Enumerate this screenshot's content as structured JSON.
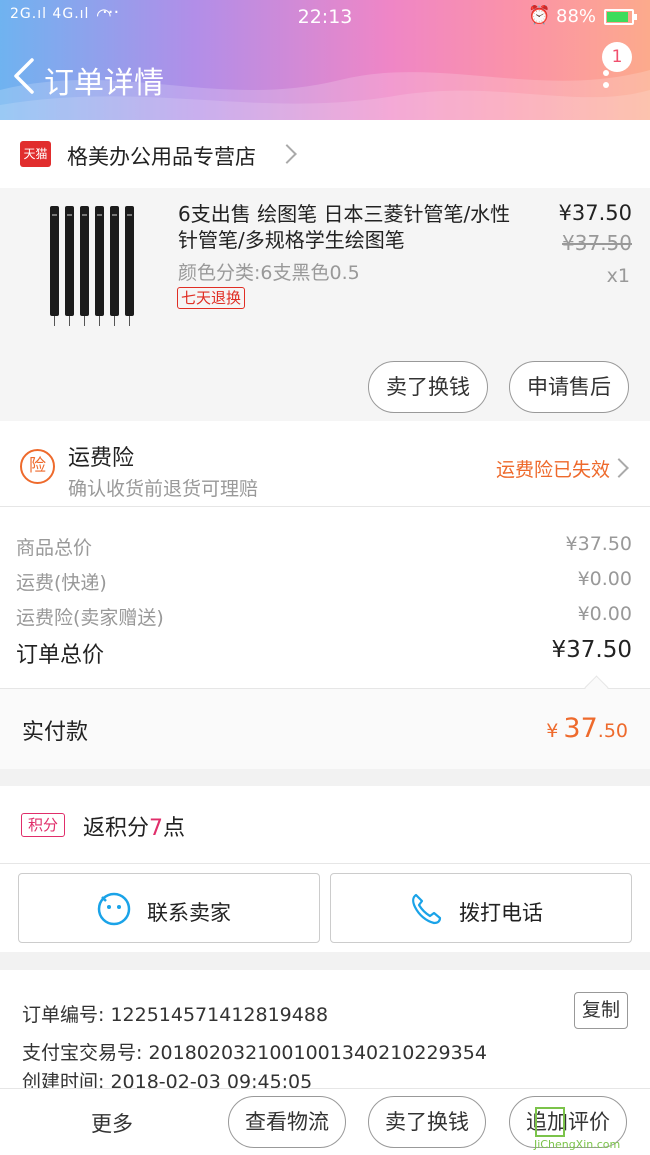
{
  "status_bar": {
    "signal": "2G.ıl 4G.ıl",
    "time": "22:13",
    "battery": "88%",
    "battery_fill": 0.88
  },
  "header": {
    "title": "订单详情",
    "badge": "1"
  },
  "store": {
    "logo": "天猫",
    "name": "格美办公用品专营店"
  },
  "product": {
    "title": "6支出售 绘图笔  日本三菱针管笔/水性针管笔/多规格学生绘图笔",
    "sku": "颜色分类:6支黑色0.5",
    "tag": "七天退换",
    "price": "¥37.50",
    "original_price": "¥37.50",
    "quantity": "x1",
    "sell_button": "卖了换钱",
    "aftersale_button": "申请售后"
  },
  "insurance": {
    "icon": "险",
    "title": "运费险",
    "subtitle": "确认收货前退货可理赔",
    "status": "运费险已失效"
  },
  "summary": {
    "rows": [
      {
        "label": "商品总价",
        "value": "¥37.50"
      },
      {
        "label": "运费(快递)",
        "value": "¥0.00"
      },
      {
        "label": "运费险(卖家赠送)",
        "value": "¥0.00"
      }
    ],
    "total_label": "订单总价",
    "total_value": "¥37.50",
    "paid_label": "实付款",
    "paid_currency": "¥",
    "paid_int": "37",
    "paid_dec": ".50"
  },
  "points": {
    "tag": "积分",
    "prefix": "返积分",
    "num": "7",
    "suffix": "点"
  },
  "contact": {
    "seller": "联系卖家",
    "phone": "拨打电话"
  },
  "order_info": {
    "order_no": "订单编号: 122514571412819488",
    "alipay_no": "支付宝交易号: 2018020321001001340210229354",
    "created": "创建时间: 2018-02-03 09:45:05",
    "copy": "复制"
  },
  "bottom_bar": {
    "more": "更多",
    "logistics": "查看物流",
    "sell": "卖了换钱",
    "review": "追加评价"
  },
  "watermark": {
    "text": "JiChengXin.com"
  },
  "colors": {
    "accent": "#ee6a2c",
    "tmall_red": "#e02e24",
    "points_pink": "#e02e6a"
  }
}
